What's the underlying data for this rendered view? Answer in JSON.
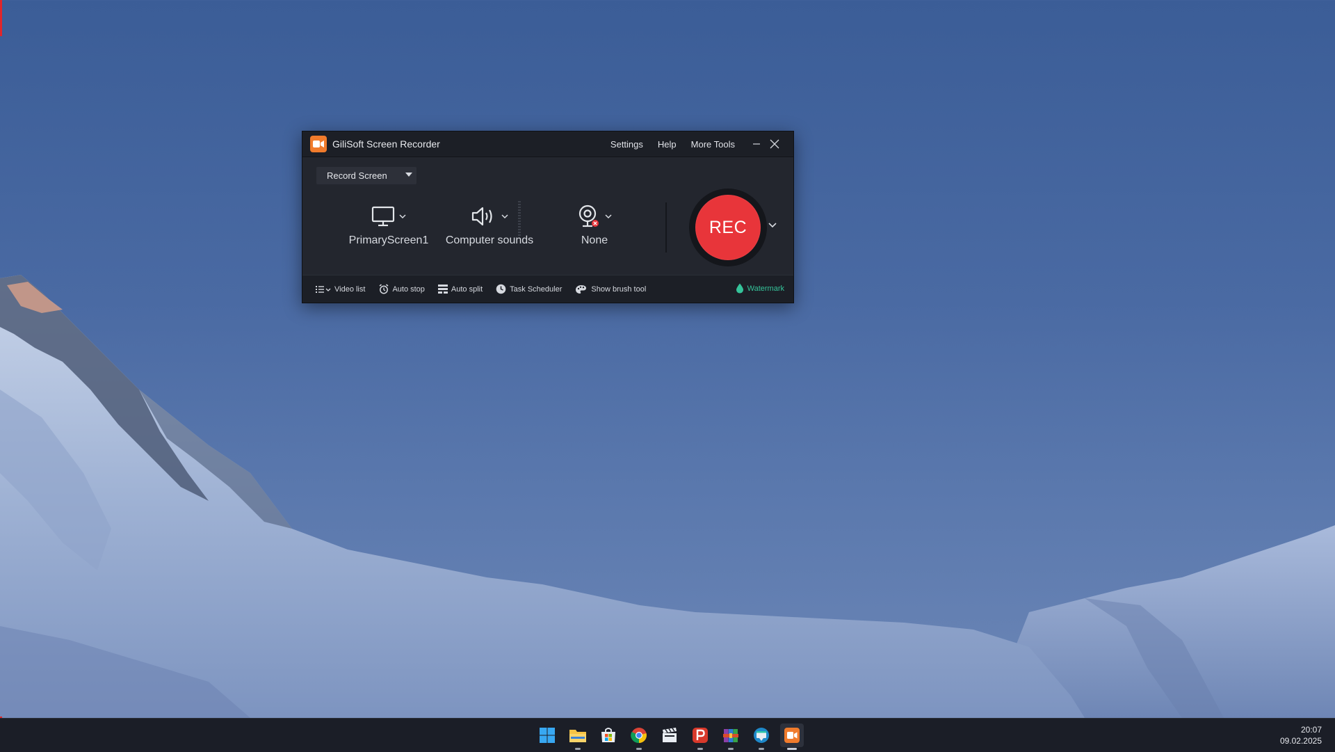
{
  "app": {
    "title": "GiliSoft Screen Recorder",
    "menu": {
      "settings": "Settings",
      "help": "Help",
      "more_tools": "More Tools"
    },
    "mode": "Record Screen",
    "sources": {
      "screen": "PrimaryScreen1",
      "audio": "Computer sounds",
      "webcam": "None"
    },
    "rec_label": "REC",
    "tools": {
      "video_list": "Video list",
      "auto_stop": "Auto stop",
      "auto_split": "Auto split",
      "task_scheduler": "Task Scheduler",
      "show_brush_tool": "Show brush tool",
      "watermark": "Watermark"
    }
  },
  "colors": {
    "rec": "#e8353a",
    "accent": "#f07b2c",
    "watermark": "#35c39a",
    "window_bg": "#23262e"
  },
  "taskbar": {
    "icons": [
      "windows-start-icon",
      "file-explorer-icon",
      "microsoft-store-icon",
      "chrome-icon",
      "clapperboard-app-icon",
      "p-app-icon",
      "archive-app-icon",
      "browser-app-icon",
      "screen-recorder-app-icon"
    ],
    "time": "20:07",
    "date": "09.02.2025"
  }
}
